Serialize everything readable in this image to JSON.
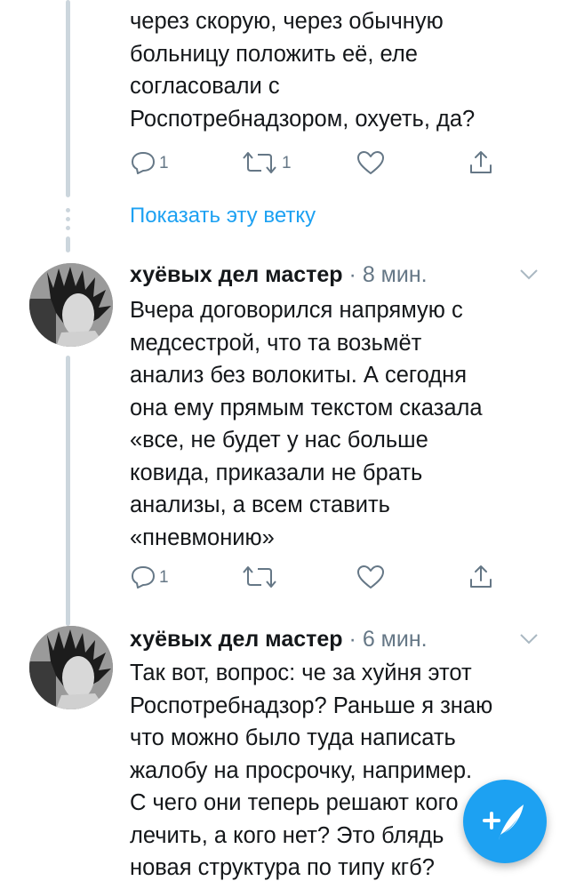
{
  "tweet_top": {
    "text": "через скорую, через обычную\nбольницу положить её, еле\nсогласовали с\nРоспотребнадзором, охуеть, да?",
    "reply_count": "1",
    "retweet_count": "1"
  },
  "show_thread": "Показать эту ветку",
  "tweet_2": {
    "name": "хуёвых дел мастер",
    "separator": "·",
    "time": "8 мин.",
    "text": "Вчера договорился напрямую с\nмедсестрой, что та возьмёт\nанализ без волокиты. А сегодня\nона ему прямым текстом сказала\n«все, не будет у нас больше\nковида, приказали не брать\nанализы, а всем ставить\n«пневмонию»",
    "reply_count": "1"
  },
  "tweet_3": {
    "name": "хуёвых дел мастер",
    "separator": "·",
    "time": "6 мин.",
    "text": "Так вот, вопрос: че за хуйня этот\nРоспотребнадзор? Раньше я знаю\nчто можно было туда написать\nжалобу на просрочку, например.\nС чего они теперь решают кого\nлечить, а кого нет? Это блядь\nновая структура по типу кгб?"
  },
  "icons": {
    "reply": "reply-icon",
    "retweet": "retweet-icon",
    "like": "heart-icon",
    "share": "share-icon",
    "compose": "compose-tweet-icon",
    "chevron": "chevron-down-icon"
  },
  "colors": {
    "accent": "#1da1f2",
    "text": "#14171a",
    "secondary": "#657786",
    "thread_line": "#ccd6dd"
  }
}
